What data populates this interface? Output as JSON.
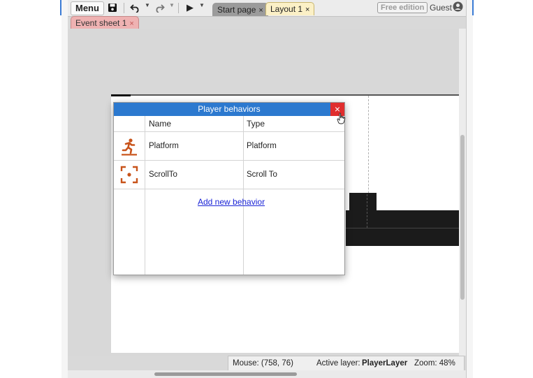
{
  "toolbar": {
    "menu_label": "Menu",
    "save_icon": "floppy-disk-icon",
    "undo_icon": "undo-icon",
    "redo_icon": "redo-icon",
    "run_icon": "play-icon",
    "dropdown_icon": "chevron-down-icon",
    "edition_badge": "Free edition",
    "user_label": "Guest",
    "user_icon": "account-circle-icon"
  },
  "tabs": [
    {
      "label": "Start page",
      "close": "×",
      "color": "#9b9b9b"
    },
    {
      "label": "Layout 1",
      "close": "×",
      "color": "#fbf0c6"
    },
    {
      "label": "Event sheet 1",
      "close": "×",
      "color": "#efb2b2"
    }
  ],
  "dialog": {
    "title": "Player behaviors",
    "close_label": "×",
    "columns": {
      "name": "Name",
      "type": "Type"
    },
    "rows": [
      {
        "icon": "running-person-icon",
        "name": "Platform",
        "type": "Platform"
      },
      {
        "icon": "scroll-target-icon",
        "name": "ScrollTo",
        "type": "Scroll To"
      }
    ],
    "add_link": "Add new behavior"
  },
  "status": {
    "mouse": "Mouse: (758, 76)",
    "active_layer_label": "Active layer:",
    "active_layer_value": "PlayerLayer",
    "zoom": "Zoom: 48%"
  },
  "colors": {
    "title_bar": "#2c79cf",
    "close_button": "#e02d2d",
    "icon_accent": "#c8531a",
    "link": "#1a24d6"
  }
}
